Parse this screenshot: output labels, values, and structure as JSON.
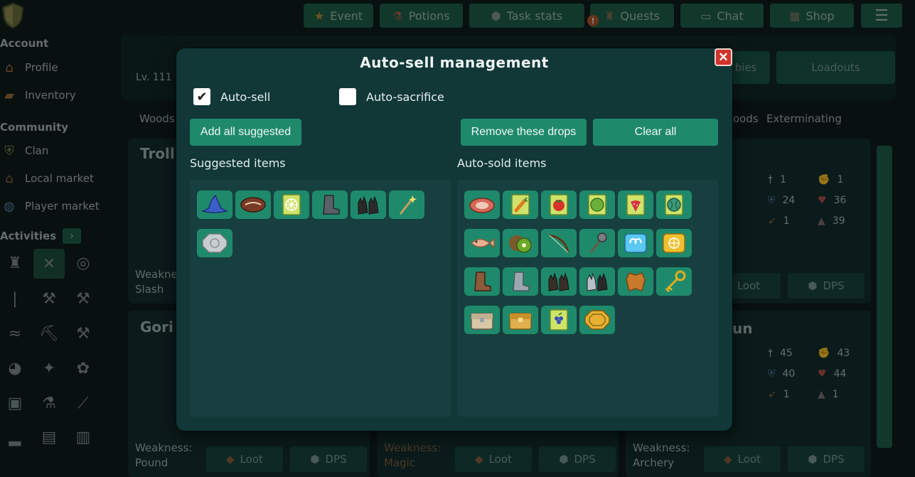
{
  "topbar": {
    "event": "Event",
    "potions": "Potions",
    "task_stats": "Task stats",
    "quests": "Quests",
    "chat": "Chat",
    "shop": "Shop"
  },
  "sidebar": {
    "account": "Account",
    "profile": "Profile",
    "inventory": "Inventory",
    "community": "Community",
    "clan": "Clan",
    "local_market": "Local market",
    "player_market": "Player market",
    "activities": "Activities"
  },
  "background": {
    "level": "Lv. 111",
    "tab_woods": "Woods",
    "tab_exterminating": "Exterminating",
    "tab_woods_right": "oods",
    "btn_bies": "bies",
    "btn_loadouts": "Loadouts",
    "card1_name": "Troll",
    "card1_weakness": "Weakne",
    "card1_weak_type": "Slash",
    "card2_name": "Gori",
    "card3_name": "un",
    "weakness_label": "Weakness:",
    "weak_pound": "Pound",
    "weak_magic": "Magic",
    "weak_archery": "Archery",
    "loot": "Loot",
    "dps": "DPS",
    "stats_top": [
      "1",
      "1",
      "24",
      "36",
      "1",
      "39"
    ],
    "stats_bottom": [
      "45",
      "43",
      "40",
      "44",
      "1",
      "1"
    ]
  },
  "modal": {
    "title": "Auto-sell management",
    "close": "✕",
    "auto_sell_label": "Auto-sell",
    "auto_sell_checked": true,
    "auto_sacrifice_label": "Auto-sacrifice",
    "auto_sacrifice_checked": false,
    "add_all_suggested": "Add all suggested",
    "remove_these_drops": "Remove these drops",
    "clear_all": "Clear all",
    "suggested_label": "Suggested items",
    "autosold_label": "Auto-sold items"
  },
  "suggested_items": [
    "wizard-hat",
    "steak",
    "cobweb-seed-pack",
    "iron-boots",
    "leather-gloves",
    "magic-wand",
    "silver-coin"
  ],
  "autosold_items": [
    "raw-meat",
    "carrot-seed-pack",
    "tomato-seed-pack",
    "cabbage-seed-pack",
    "strawberry-seed-pack",
    "watermelon-seed-pack",
    "fish",
    "kiwi",
    "bow",
    "mace",
    "water-rune",
    "fire-rune",
    "leather-boots",
    "steel-boots",
    "dark-gloves",
    "steel-gauntlets",
    "leather-hide",
    "golden-key",
    "silver-chest",
    "golden-chest",
    "grape-seed-pack",
    "gold-coin"
  ],
  "colors": {
    "modal_bg": "#113737",
    "panel_bg": "#173f3f",
    "button_green": "#1f8a6b",
    "close_red": "#d0342c"
  }
}
